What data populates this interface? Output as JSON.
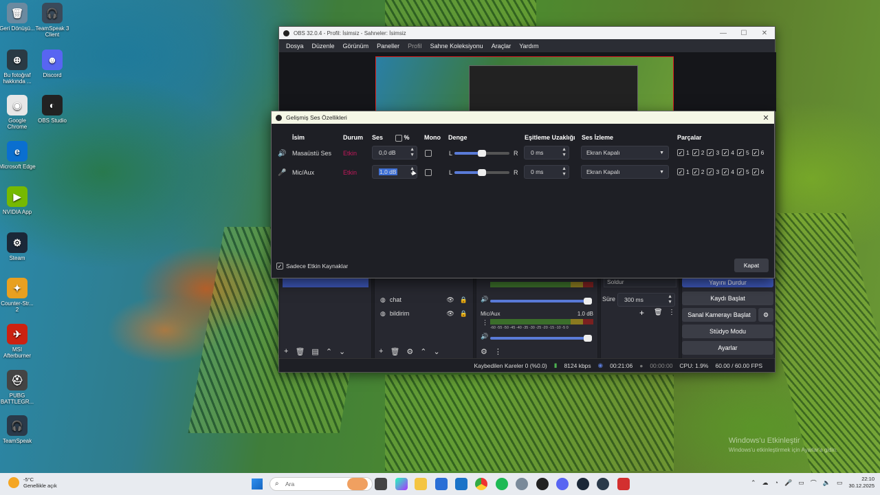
{
  "desktop": {
    "icons": [
      {
        "label": "Geri Dönüşü...",
        "glyph": "🗑"
      },
      {
        "label": "TeamSpeak 3 Client",
        "glyph": "🎧"
      },
      {
        "label": "Bu fotoğraf hakkında ...",
        "glyph": "⊕"
      },
      {
        "label": "Discord",
        "glyph": "☻"
      },
      {
        "label": "Google Chrome",
        "glyph": "◉"
      },
      {
        "label": "OBS Studio",
        "glyph": "◐"
      },
      {
        "label": "Microsoft Edge",
        "glyph": "e"
      },
      {
        "label": "NVIDIA App",
        "glyph": "▶"
      },
      {
        "label": "Steam",
        "glyph": "⚙"
      },
      {
        "label": "Counter-Str... 2",
        "glyph": "✦"
      },
      {
        "label": "MSI Afterburner",
        "glyph": "✈"
      },
      {
        "label": "PUBG BATTLEGR...",
        "glyph": "⛑"
      },
      {
        "label": "TeamSpeak",
        "glyph": "🎧"
      }
    ],
    "watermark_title": "Windows'u Etkinleştir",
    "watermark_sub": "Windows'u etkinleştirmek için Ayarlar'a gidin."
  },
  "obs": {
    "title": "OBS 32.0.4 - Profil: İsimsiz - Sahneler: İsimsiz",
    "menu": [
      "Dosya",
      "Düzenle",
      "Görünüm",
      "Paneller",
      "Profil",
      "Sahne Koleksiyonu",
      "Araçlar",
      "Yardım"
    ],
    "sources": [
      {
        "name": "chat"
      },
      {
        "name": "bildirim"
      }
    ],
    "mixer": {
      "mic_label": "Mic/Aux",
      "mic_db": "1.0 dB",
      "scale": "-60 -55 -50 -45 -40 -35 -30 -25 -20 -15 -10 -5 0"
    },
    "transition": {
      "type": "Soldur",
      "duration_label": "Süre",
      "duration_value": "300 ms"
    },
    "controls": {
      "stop_stream": "Yayını Durdur",
      "start_record": "Kaydı Başlat",
      "virtual_cam": "Sanal Kamerayı Başlat",
      "studio_mode": "Stüdyo Modu",
      "settings": "Ayarlar"
    },
    "status": {
      "dropped": "Kaybedilen Kareler 0 (%0.0)",
      "bitrate": "8124 kbps",
      "live_time": "00:21:06",
      "rec_time": "00:00:00",
      "cpu": "CPU: 1.9%",
      "fps": "60.00 / 60.00 FPS"
    }
  },
  "dialog": {
    "title": "Gelişmiş Ses Özellikleri",
    "headers": {
      "name": "İsim",
      "status": "Durum",
      "volume": "Ses",
      "percent": "%",
      "mono": "Mono",
      "balance": "Denge",
      "sync": "Eşitleme Uzaklığı",
      "monitor": "Ses İzleme",
      "tracks": "Parçalar"
    },
    "rows": [
      {
        "name": "Masaüstü Ses",
        "status": "Etkin",
        "volume": "0,0 dB",
        "balance_l": "L",
        "balance_r": "R",
        "balance": 0.5,
        "sync": "0 ms",
        "monitor": "Ekran Kapalı",
        "tracks": [
          "1",
          "2",
          "3",
          "4",
          "5",
          "6"
        ]
      },
      {
        "name": "Mic/Aux",
        "status": "Etkin",
        "volume": "1,0 dB",
        "balance_l": "L",
        "balance_r": "R",
        "balance": 0.5,
        "sync": "0 ms",
        "monitor": "Ekran Kapalı",
        "tracks": [
          "1",
          "2",
          "3",
          "4",
          "5",
          "6"
        ]
      }
    ],
    "only_active": "Sadece Etkin Kaynaklar",
    "close": "Kapat"
  },
  "taskbar": {
    "temp": "-5°C",
    "weather": "Genellikle açık",
    "search_placeholder": "Ara",
    "time": "22:10",
    "date": "30.12.2025"
  }
}
